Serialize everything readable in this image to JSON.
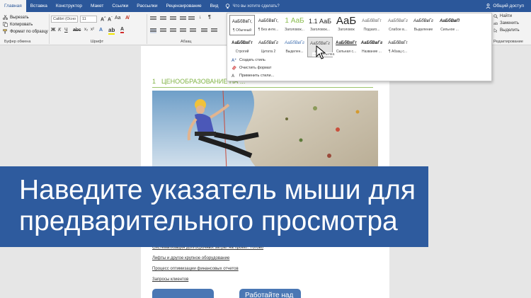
{
  "colors": {
    "ribbon_blue": "#2b579a",
    "banner_blue": "#2e5b9e",
    "heading_green": "#7fb243",
    "button_blue": "#4a77b4"
  },
  "menu": {
    "tabs": [
      "Главная",
      "Вставка",
      "Конструктор",
      "Макет",
      "Ссылки",
      "Рассылки",
      "Рецензирование",
      "Вид"
    ],
    "tell_me": "Что вы хотите сделать?",
    "share": "Общий доступ"
  },
  "clipboard": {
    "cut": "Вырезать",
    "copy": "Копировать",
    "format_painter": "Формат по образцу",
    "group_label": "Буфер обмена"
  },
  "font": {
    "name": "Calibri (Осно",
    "size": "11",
    "group_label": "Шрифт"
  },
  "paragraph": {
    "group_label": "Абзац"
  },
  "editing": {
    "find": "Найти",
    "replace": "Заменить",
    "select": "Выделить",
    "group_label": "Редактирование"
  },
  "styles": {
    "row1": [
      {
        "sample": "АаБбВвГг,",
        "name": "¶ Обычный"
      },
      {
        "sample": "АаБбВвГг,",
        "name": "¶ Без инте..."
      },
      {
        "sample": "1 АаБ",
        "name": "Заголовок..."
      },
      {
        "sample": "1.1 АаБ",
        "name": "Заголовок..."
      },
      {
        "sample": "АаБ",
        "name": "Заголовок"
      },
      {
        "sample": "АаБбВвГг",
        "name": "Подзаго..."
      },
      {
        "sample": "АаБбВвГг",
        "name": "Слабое в..."
      },
      {
        "sample": "АаБбВвГг",
        "name": "Выделение"
      },
      {
        "sample": "АаБбВвП",
        "name": "Сильное ..."
      }
    ],
    "row2": [
      {
        "sample": "АаБбВвГг",
        "name": "Строгий"
      },
      {
        "sample": "АаБбВвГг",
        "name": "Цитата 2"
      },
      {
        "sample": "АаБбВвГг",
        "name": "Выделен..."
      },
      {
        "sample": "АаБбВвГг",
        "name": "Сла..."
      },
      {
        "sample": "АаБбВвГг",
        "name": "Сильная с..."
      },
      {
        "sample": "АаБбВвГг",
        "name": "Название ..."
      },
      {
        "sample": "АаБбВвГг",
        "name": "¶ Абзац с..."
      }
    ],
    "tooltip": "...ая ссылка",
    "menu": [
      "Создать стиль",
      "Очистить формат",
      "Применить стили..."
    ]
  },
  "document": {
    "heading_number": "1",
    "heading_text": "ЦЕНООБРАЗОВАНИЕ НА ...",
    "links": [
      "Систематизация долгосрочных затрат на проект: Готово",
      "Лифты и другое крупное оборудование",
      "Процесс оптимизации финансовых отчетов",
      "Запросы клиентов"
    ],
    "button_right": "Работайте над"
  },
  "banner": {
    "line1": "Наведите указатель мыши для",
    "line2": "предварительного просмотра"
  }
}
